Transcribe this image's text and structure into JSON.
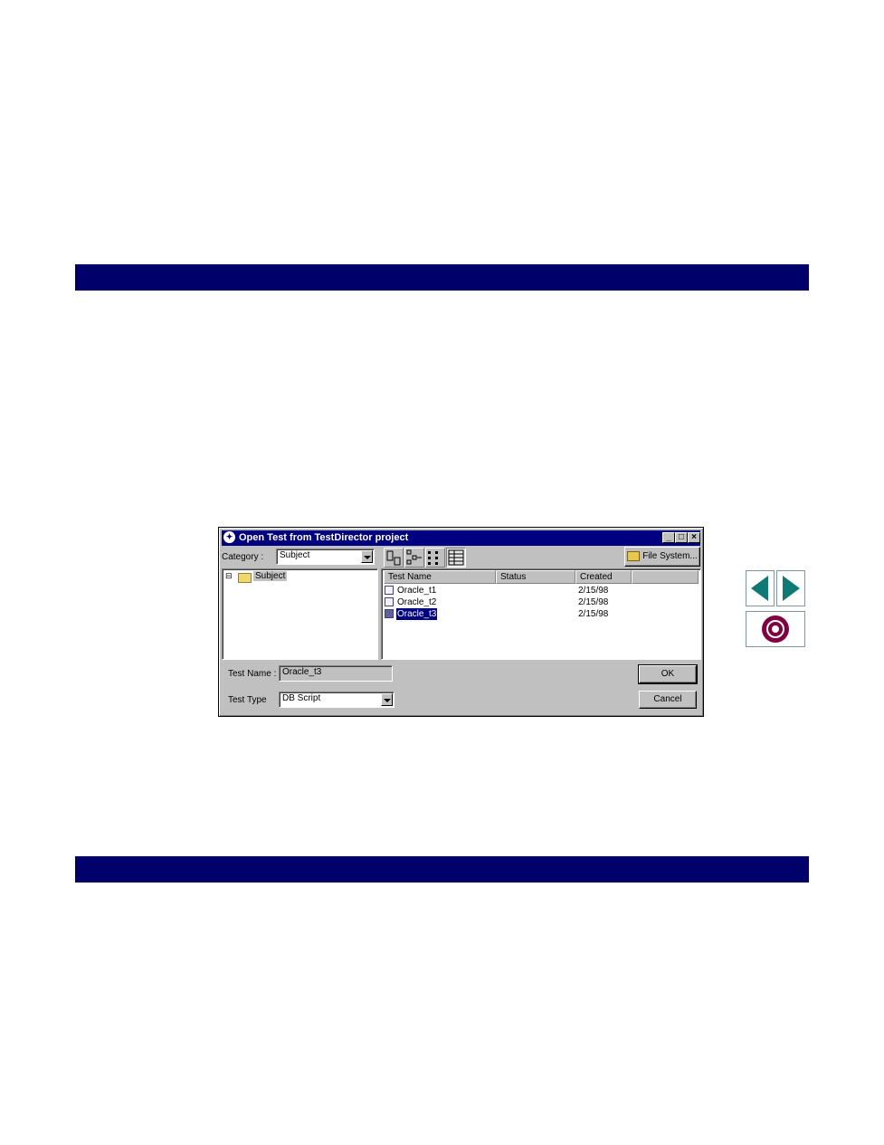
{
  "dialog": {
    "title": "Open Test from TestDirector project",
    "category_label": "Category :",
    "category_value": "Subject",
    "tree_root": "Subject",
    "file_system_button": "File System...",
    "columns": [
      "Test Name",
      "Status",
      "Created"
    ],
    "rows": [
      {
        "name": "Oracle_t1",
        "status": "",
        "created": "2/15/98"
      },
      {
        "name": "Oracle_t2",
        "status": "",
        "created": "2/15/98"
      },
      {
        "name": "Oracle_t3",
        "status": "",
        "created": "2/15/98",
        "selected": true
      }
    ],
    "test_name_label": "Test Name :",
    "test_name_value": "Oracle_t3",
    "test_type_label": "Test Type",
    "test_type_value": "DB Script",
    "ok_button": "OK",
    "cancel_button": "Cancel",
    "title_buttons": [
      "_",
      "□",
      "×"
    ]
  },
  "icons": {
    "prev_page": "left-arrow-icon",
    "next_page": "right-arrow-icon",
    "home": "target-icon",
    "colors": {
      "band": "#00006b",
      "nav_teal": "#0e7a77",
      "nav_maroon": "#800040"
    }
  }
}
